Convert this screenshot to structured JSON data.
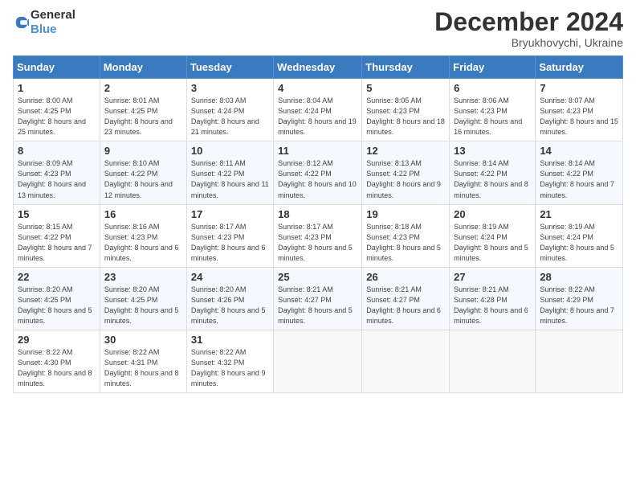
{
  "logo": {
    "general": "General",
    "blue": "Blue"
  },
  "header": {
    "month": "December 2024",
    "location": "Bryukhovychi, Ukraine"
  },
  "days_of_week": [
    "Sunday",
    "Monday",
    "Tuesday",
    "Wednesday",
    "Thursday",
    "Friday",
    "Saturday"
  ],
  "weeks": [
    [
      {
        "day": "1",
        "sunrise": "8:00 AM",
        "sunset": "4:25 PM",
        "daylight": "8 hours and 25 minutes."
      },
      {
        "day": "2",
        "sunrise": "8:01 AM",
        "sunset": "4:25 PM",
        "daylight": "8 hours and 23 minutes."
      },
      {
        "day": "3",
        "sunrise": "8:03 AM",
        "sunset": "4:24 PM",
        "daylight": "8 hours and 21 minutes."
      },
      {
        "day": "4",
        "sunrise": "8:04 AM",
        "sunset": "4:24 PM",
        "daylight": "8 hours and 19 minutes."
      },
      {
        "day": "5",
        "sunrise": "8:05 AM",
        "sunset": "4:23 PM",
        "daylight": "8 hours and 18 minutes."
      },
      {
        "day": "6",
        "sunrise": "8:06 AM",
        "sunset": "4:23 PM",
        "daylight": "8 hours and 16 minutes."
      },
      {
        "day": "7",
        "sunrise": "8:07 AM",
        "sunset": "4:23 PM",
        "daylight": "8 hours and 15 minutes."
      }
    ],
    [
      {
        "day": "8",
        "sunrise": "8:09 AM",
        "sunset": "4:23 PM",
        "daylight": "8 hours and 13 minutes."
      },
      {
        "day": "9",
        "sunrise": "8:10 AM",
        "sunset": "4:22 PM",
        "daylight": "8 hours and 12 minutes."
      },
      {
        "day": "10",
        "sunrise": "8:11 AM",
        "sunset": "4:22 PM",
        "daylight": "8 hours and 11 minutes."
      },
      {
        "day": "11",
        "sunrise": "8:12 AM",
        "sunset": "4:22 PM",
        "daylight": "8 hours and 10 minutes."
      },
      {
        "day": "12",
        "sunrise": "8:13 AM",
        "sunset": "4:22 PM",
        "daylight": "8 hours and 9 minutes."
      },
      {
        "day": "13",
        "sunrise": "8:14 AM",
        "sunset": "4:22 PM",
        "daylight": "8 hours and 8 minutes."
      },
      {
        "day": "14",
        "sunrise": "8:14 AM",
        "sunset": "4:22 PM",
        "daylight": "8 hours and 7 minutes."
      }
    ],
    [
      {
        "day": "15",
        "sunrise": "8:15 AM",
        "sunset": "4:22 PM",
        "daylight": "8 hours and 7 minutes."
      },
      {
        "day": "16",
        "sunrise": "8:16 AM",
        "sunset": "4:23 PM",
        "daylight": "8 hours and 6 minutes."
      },
      {
        "day": "17",
        "sunrise": "8:17 AM",
        "sunset": "4:23 PM",
        "daylight": "8 hours and 6 minutes."
      },
      {
        "day": "18",
        "sunrise": "8:17 AM",
        "sunset": "4:23 PM",
        "daylight": "8 hours and 5 minutes."
      },
      {
        "day": "19",
        "sunrise": "8:18 AM",
        "sunset": "4:23 PM",
        "daylight": "8 hours and 5 minutes."
      },
      {
        "day": "20",
        "sunrise": "8:19 AM",
        "sunset": "4:24 PM",
        "daylight": "8 hours and 5 minutes."
      },
      {
        "day": "21",
        "sunrise": "8:19 AM",
        "sunset": "4:24 PM",
        "daylight": "8 hours and 5 minutes."
      }
    ],
    [
      {
        "day": "22",
        "sunrise": "8:20 AM",
        "sunset": "4:25 PM",
        "daylight": "8 hours and 5 minutes."
      },
      {
        "day": "23",
        "sunrise": "8:20 AM",
        "sunset": "4:25 PM",
        "daylight": "8 hours and 5 minutes."
      },
      {
        "day": "24",
        "sunrise": "8:20 AM",
        "sunset": "4:26 PM",
        "daylight": "8 hours and 5 minutes."
      },
      {
        "day": "25",
        "sunrise": "8:21 AM",
        "sunset": "4:27 PM",
        "daylight": "8 hours and 5 minutes."
      },
      {
        "day": "26",
        "sunrise": "8:21 AM",
        "sunset": "4:27 PM",
        "daylight": "8 hours and 6 minutes."
      },
      {
        "day": "27",
        "sunrise": "8:21 AM",
        "sunset": "4:28 PM",
        "daylight": "8 hours and 6 minutes."
      },
      {
        "day": "28",
        "sunrise": "8:22 AM",
        "sunset": "4:29 PM",
        "daylight": "8 hours and 7 minutes."
      }
    ],
    [
      {
        "day": "29",
        "sunrise": "8:22 AM",
        "sunset": "4:30 PM",
        "daylight": "8 hours and 8 minutes."
      },
      {
        "day": "30",
        "sunrise": "8:22 AM",
        "sunset": "4:31 PM",
        "daylight": "8 hours and 8 minutes."
      },
      {
        "day": "31",
        "sunrise": "8:22 AM",
        "sunset": "4:32 PM",
        "daylight": "8 hours and 9 minutes."
      },
      null,
      null,
      null,
      null
    ]
  ],
  "labels": {
    "sunrise": "Sunrise:",
    "sunset": "Sunset:",
    "daylight": "Daylight:"
  }
}
